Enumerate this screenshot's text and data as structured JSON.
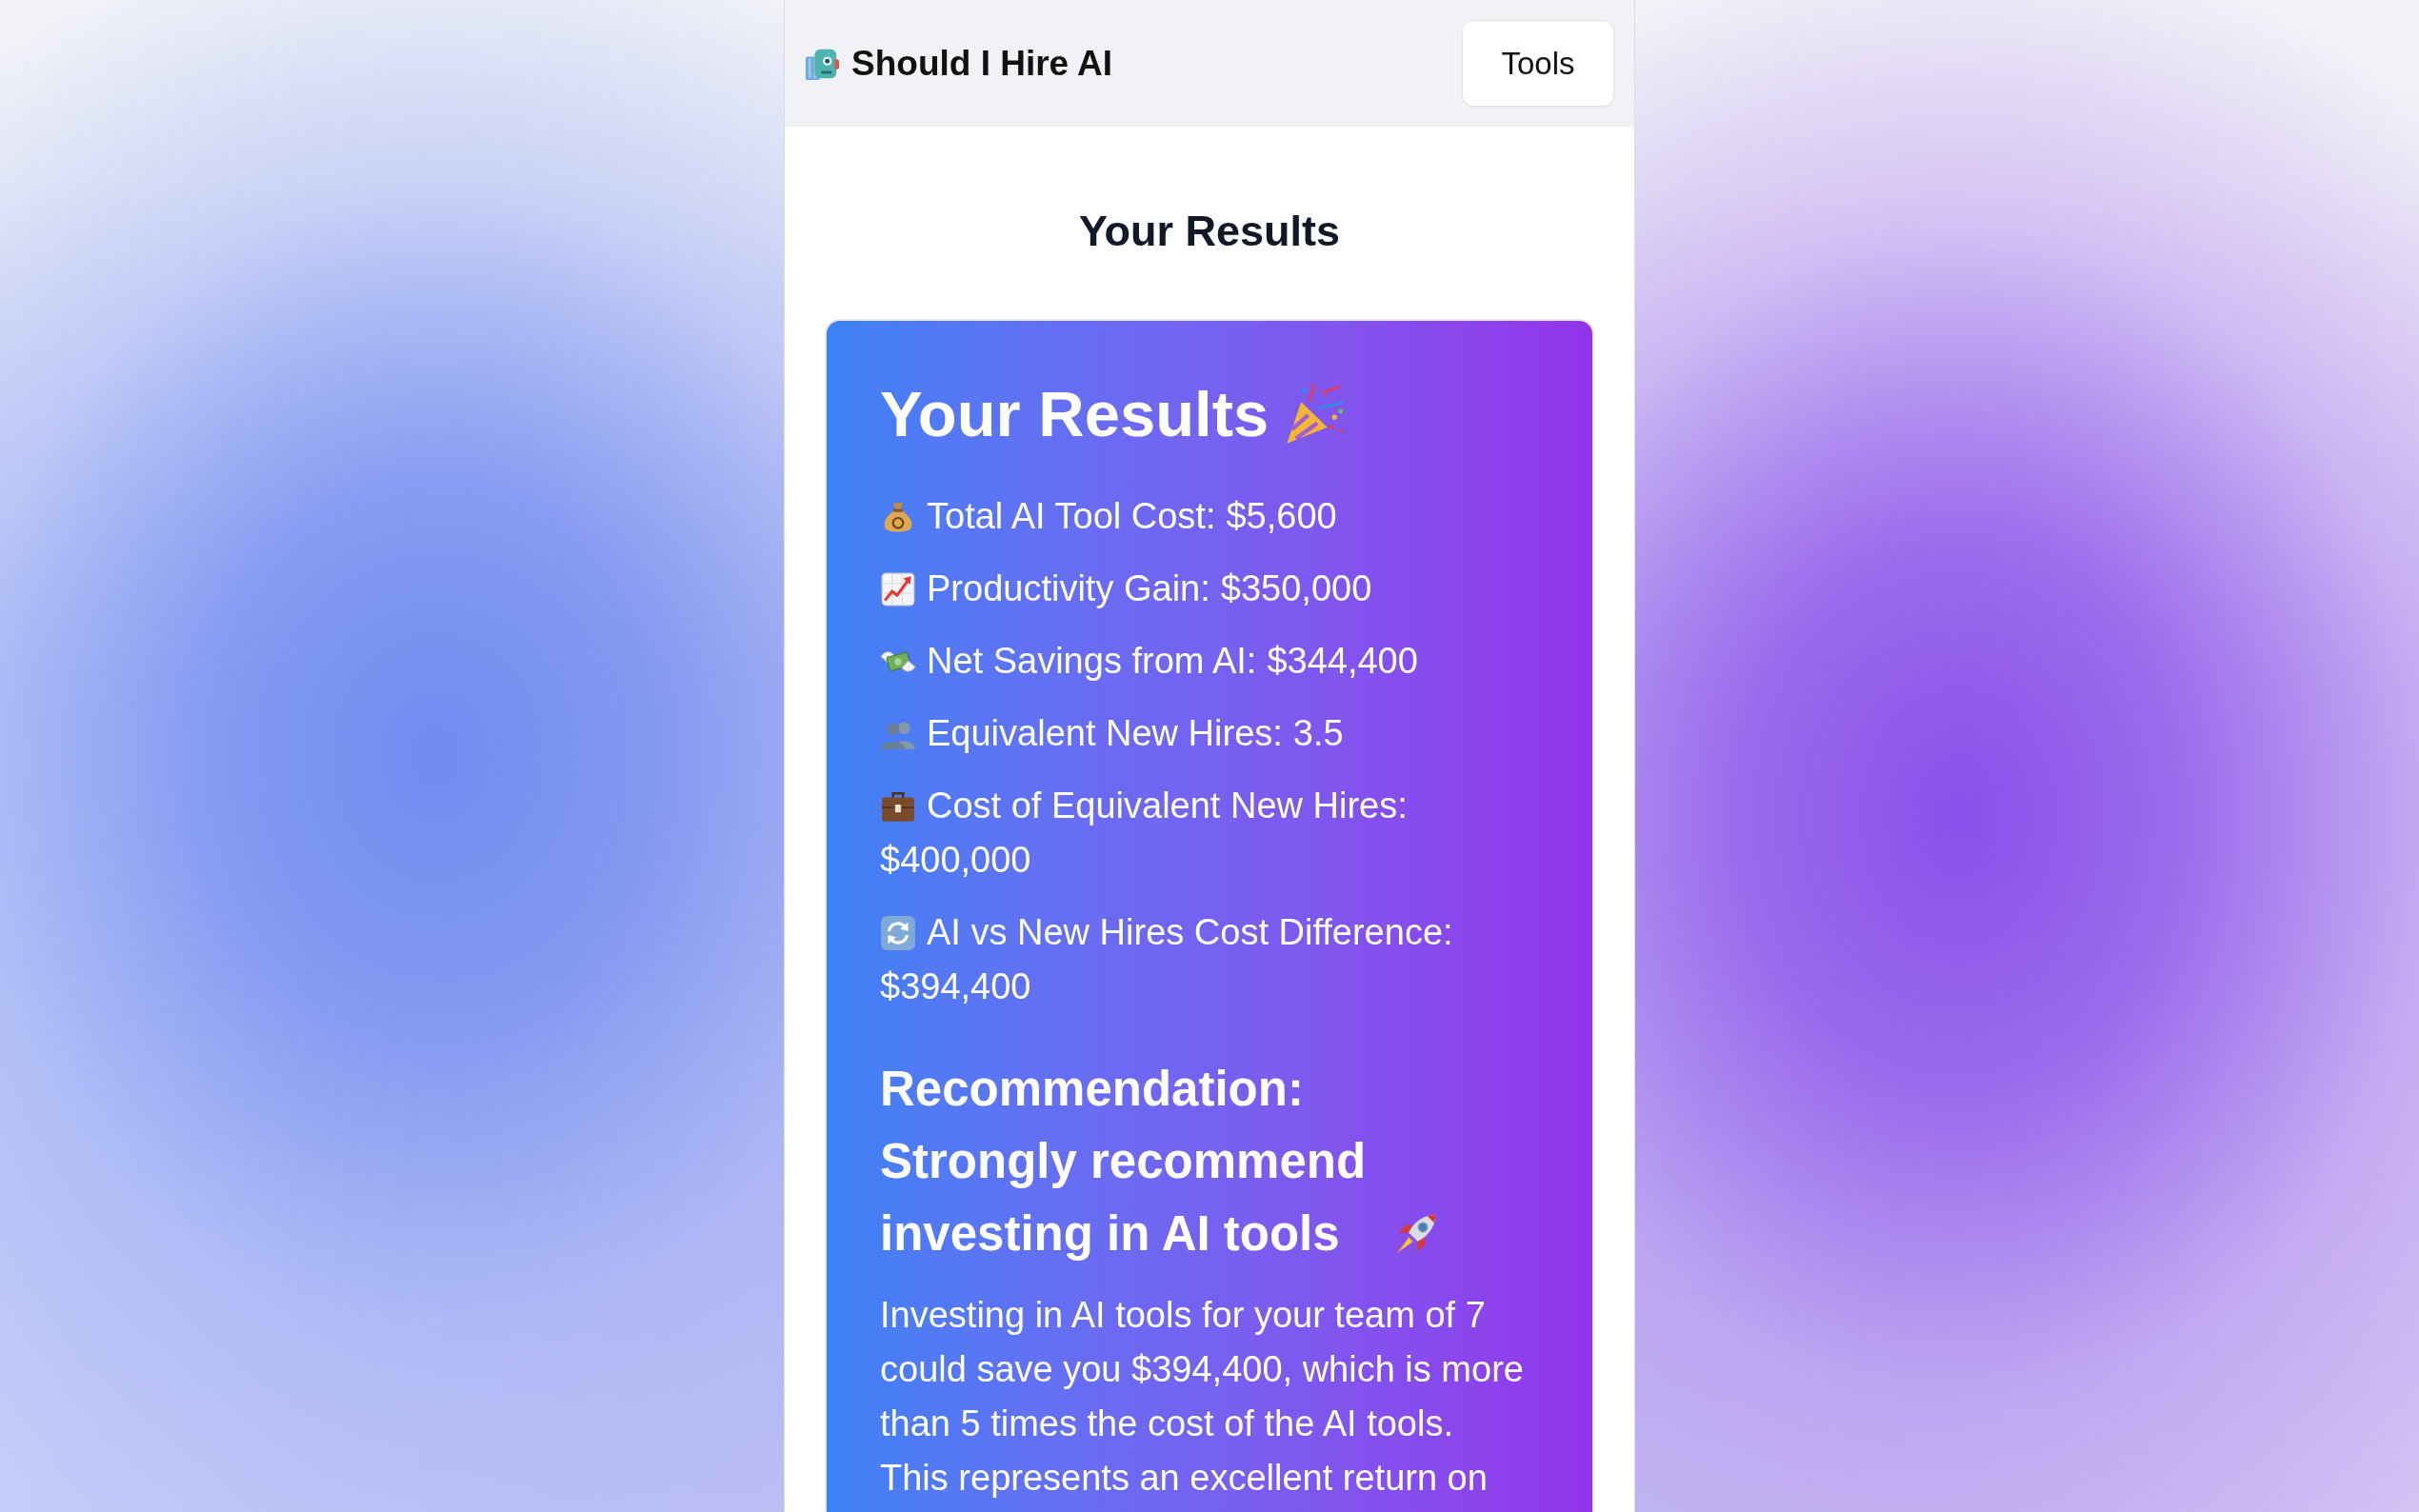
{
  "header": {
    "title": "Should I Hire AI",
    "button": "Tools"
  },
  "page_title": "Your Results",
  "results_card": {
    "title": "Your Results",
    "metrics": [
      {
        "kind": "tool_cost",
        "label": "Total AI Tool Cost:",
        "value": "$5,600"
      },
      {
        "kind": "productivity_gain",
        "label": "Productivity Gain:",
        "value": "$350,000"
      },
      {
        "kind": "net_savings",
        "label": "Net Savings from AI:",
        "value": "$344,400"
      },
      {
        "kind": "equivalent_hires",
        "label": "Equivalent New Hires:",
        "value": "3.5"
      },
      {
        "kind": "hires_cost",
        "label": "Cost of Equivalent New Hires:",
        "value": "$400,000"
      },
      {
        "kind": "cost_difference",
        "label": "AI vs New Hires Cost Difference:",
        "value": "$394,400"
      }
    ],
    "recommendation": {
      "heading": "Recommendation: Strongly recommend investing in AI tools",
      "text": "Investing in AI tools for your team of 7 could save you $394,400, which is more than 5 times the cost of the AI tools. This represents an excellent return on"
    }
  }
}
